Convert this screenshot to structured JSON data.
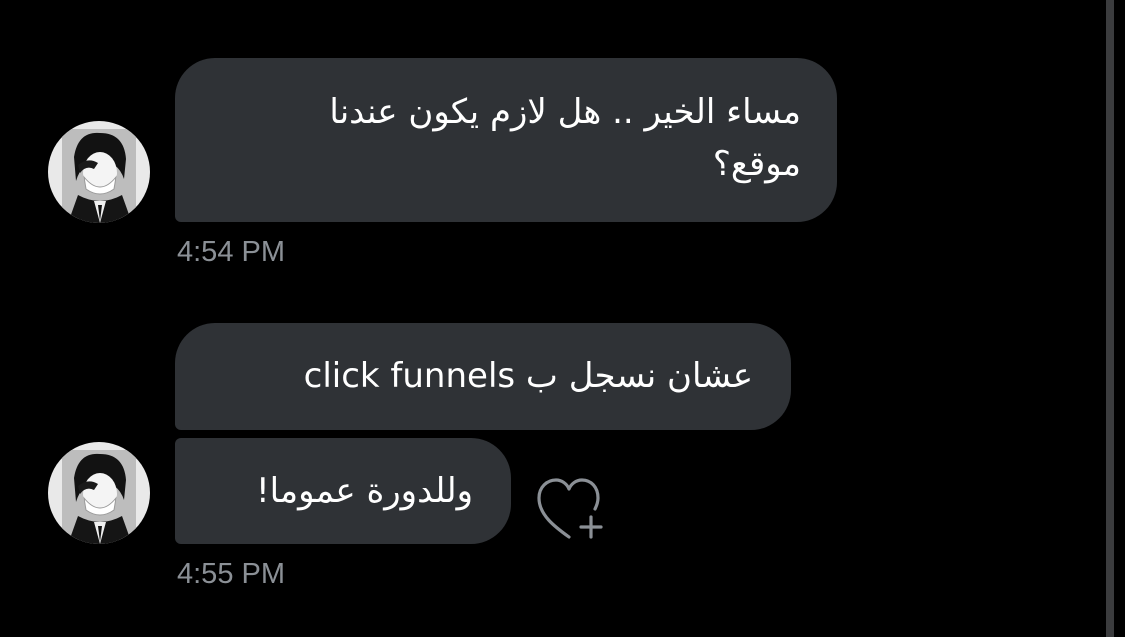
{
  "conversation": {
    "messages": [
      {
        "text_line1": "مساء الخير .. هل لازم يكون عندنا",
        "text_line2": "موقع؟"
      },
      {
        "text": "عشان نسجل ب click funnels"
      },
      {
        "text": "وللدورة عموما!"
      }
    ],
    "timestamps": [
      "4:54 PM",
      "4:55 PM"
    ]
  },
  "actions": {
    "like_icon": "heart-plus-icon"
  },
  "colors": {
    "background": "#000000",
    "bubble": "#2f3236",
    "timestamp": "#8b9096",
    "icon": "#8b9096"
  }
}
